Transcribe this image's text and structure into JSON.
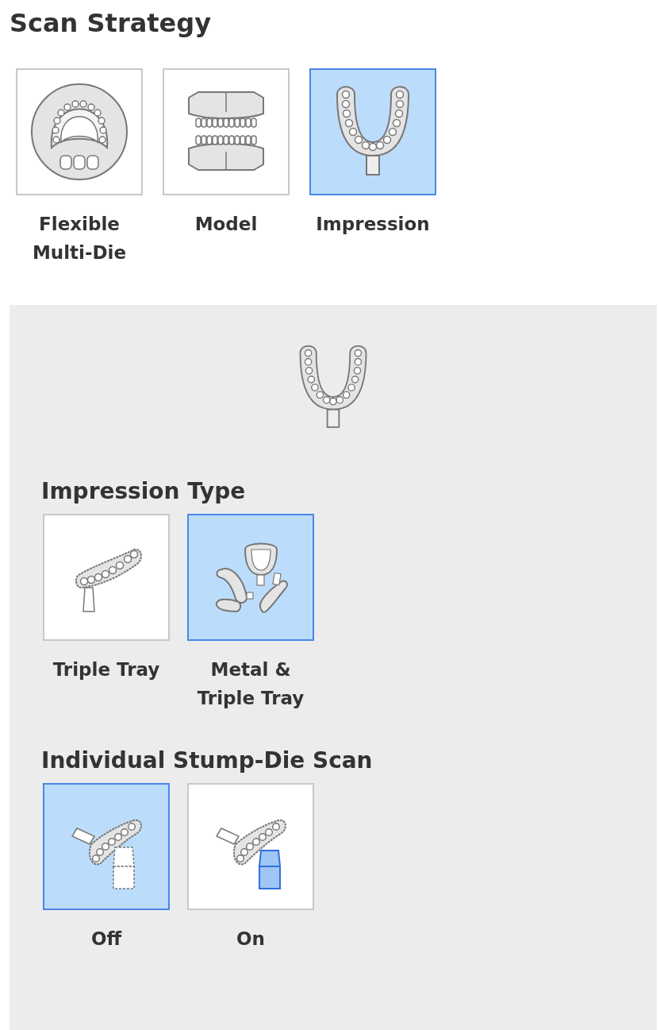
{
  "title": "Scan Strategy",
  "strategies": [
    {
      "label": "Flexible Multi-Die",
      "kind": "arch",
      "selected": false
    },
    {
      "label": "Model",
      "kind": "model",
      "selected": false
    },
    {
      "label": "Impression",
      "kind": "impression",
      "selected": true
    }
  ],
  "preview": {
    "kind": "impression"
  },
  "sections": [
    {
      "title": "Impression Type",
      "options": [
        {
          "label": "Triple Tray",
          "kind": "triple-tray",
          "selected": false
        },
        {
          "label": "Metal & Triple Tray",
          "kind": "metal-triple",
          "selected": true
        }
      ]
    },
    {
      "title": "Individual Stump-Die Scan",
      "options": [
        {
          "label": "Off",
          "kind": "stump-off",
          "selected": true
        },
        {
          "label": "On",
          "kind": "stump-on",
          "selected": false
        }
      ]
    }
  ]
}
